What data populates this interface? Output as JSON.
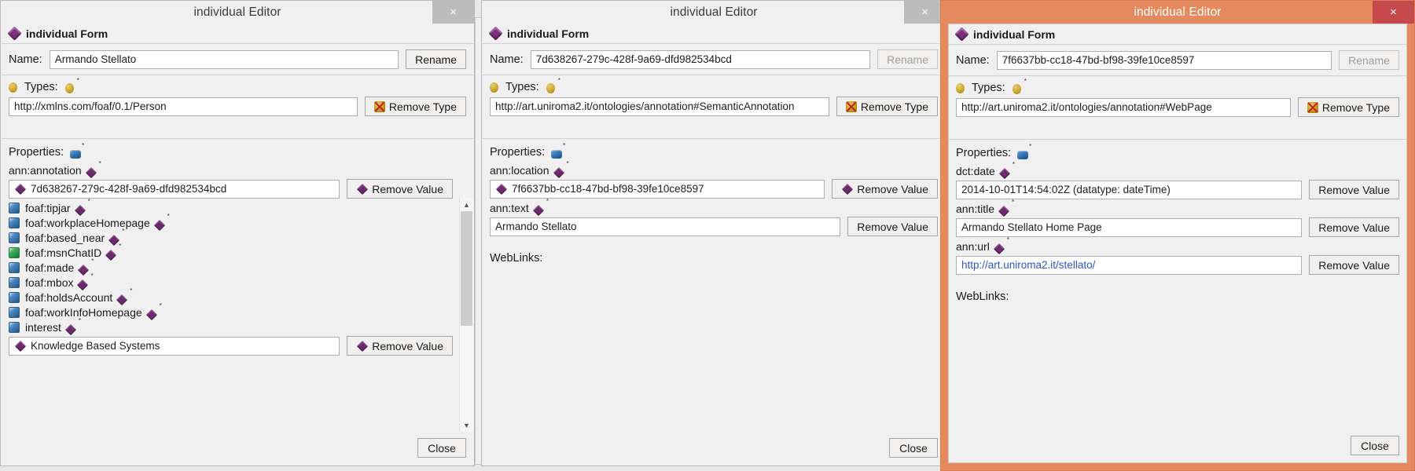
{
  "colors": {
    "active_title_bg": "#e5895f",
    "active_close_bg": "#c64a4c",
    "inactive_title_bg": "#f0f0f0",
    "inactive_close_bg": "#bcbcbc",
    "link_text": "#2f55c8",
    "object_property_icon": "#2d6fad",
    "datatype_property_icon": "#3fae5c",
    "individual_icon": "#7d2e7d"
  },
  "windows": [
    {
      "title": "individual Editor",
      "close_label": "×",
      "form_header": "individual Form",
      "name_label": "Name:",
      "name_value": "Armando Stellato",
      "rename_label": "Rename",
      "rename_disabled": false,
      "types_label": "Types:",
      "type_value": "http://xmlns.com/foaf/0.1/Person",
      "remove_type_label": "Remove Type",
      "properties_label": "Properties:",
      "properties": [
        {
          "name": "ann:annotation",
          "icon": "none",
          "value": "7d638267-279c-428f-9a69-dfd982534bcd",
          "value_icon": "diamond",
          "remove_label": "Remove Value",
          "remove_icon": "diamond"
        },
        {
          "name": "foaf:tipjar",
          "icon": "object-property"
        },
        {
          "name": "foaf:workplaceHomepage",
          "icon": "object-property"
        },
        {
          "name": "foaf:based_near",
          "icon": "object-property"
        },
        {
          "name": "foaf:msnChatID",
          "icon": "datatype-property"
        },
        {
          "name": "foaf:made",
          "icon": "object-property"
        },
        {
          "name": "foaf:mbox",
          "icon": "object-property"
        },
        {
          "name": "foaf:holdsAccount",
          "icon": "object-property"
        },
        {
          "name": "foaf:workInfoHomepage",
          "icon": "object-property"
        },
        {
          "name": "interest",
          "icon": "object-property",
          "value": "Knowledge Based Systems",
          "value_icon": "diamond",
          "remove_label": "Remove Value",
          "remove_icon": "diamond"
        }
      ],
      "close_button_label": "Close"
    },
    {
      "title": "individual Editor",
      "close_label": "×",
      "form_header": "individual Form",
      "name_label": "Name:",
      "name_value": "7d638267-279c-428f-9a69-dfd982534bcd",
      "rename_label": "Rename",
      "rename_disabled": true,
      "types_label": "Types:",
      "type_value": "http://art.uniroma2.it/ontologies/annotation#SemanticAnnotation",
      "remove_type_label": "Remove Type",
      "properties_label": "Properties:",
      "properties": [
        {
          "name": "ann:location",
          "icon": "none",
          "value": "7f6637bb-cc18-47bd-bf98-39fe10ce8597",
          "value_icon": "diamond",
          "remove_label": "Remove Value",
          "remove_icon": "diamond"
        },
        {
          "name": "ann:text",
          "icon": "none",
          "value": "Armando Stellato",
          "value_icon": "none",
          "remove_label": "Remove Value",
          "remove_icon": "none"
        }
      ],
      "weblinks_label": "WebLinks:",
      "close_button_label": "Close"
    },
    {
      "title": "individual Editor",
      "close_label": "×",
      "form_header": "individual Form",
      "name_label": "Name:",
      "name_value": "7f6637bb-cc18-47bd-bf98-39fe10ce8597",
      "rename_label": "Rename",
      "rename_disabled": true,
      "types_label": "Types:",
      "type_value": "http://art.uniroma2.it/ontologies/annotation#WebPage",
      "remove_type_label": "Remove Type",
      "properties_label": "Properties:",
      "properties": [
        {
          "name": "dct:date",
          "icon": "none",
          "value": "2014-10-01T14:54:02Z (datatype: dateTime)",
          "value_icon": "none",
          "remove_label": "Remove Value",
          "remove_icon": "none"
        },
        {
          "name": "ann:title",
          "icon": "none",
          "value": "Armando Stellato Home Page",
          "value_icon": "none",
          "remove_label": "Remove Value",
          "remove_icon": "none"
        },
        {
          "name": "ann:url",
          "icon": "none",
          "value": "http://art.uniroma2.it/stellato/",
          "value_icon": "none",
          "is_link": true,
          "remove_label": "Remove Value",
          "remove_icon": "none"
        }
      ],
      "weblinks_label": "WebLinks:",
      "close_button_label": "Close"
    }
  ]
}
